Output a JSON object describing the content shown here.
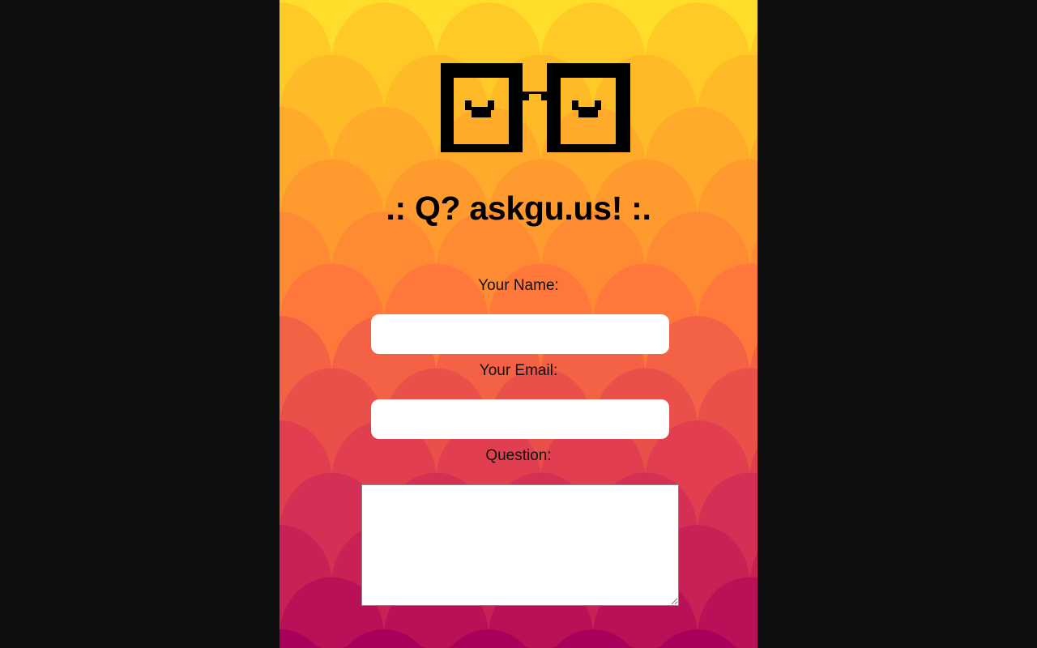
{
  "site": {
    "title": ".: Q? askgu.us! :.",
    "logo": "glasses-logo"
  },
  "form": {
    "name_label": "Your Name:",
    "name_value": "",
    "email_label": "Your Email:",
    "email_value": "",
    "question_label": "Question:",
    "question_value": ""
  },
  "theme": {
    "background_top": "#ffdd2b",
    "scale_colors": [
      "#ffc926",
      "#ffbb27",
      "#ffaa2a",
      "#ff9a2e",
      "#ff8a34",
      "#ff773b",
      "#f36244",
      "#e9504a",
      "#e13e4f",
      "#d42f55",
      "#c82155",
      "#b81157",
      "#a8005a"
    ],
    "outside": "#0e0e0e"
  }
}
